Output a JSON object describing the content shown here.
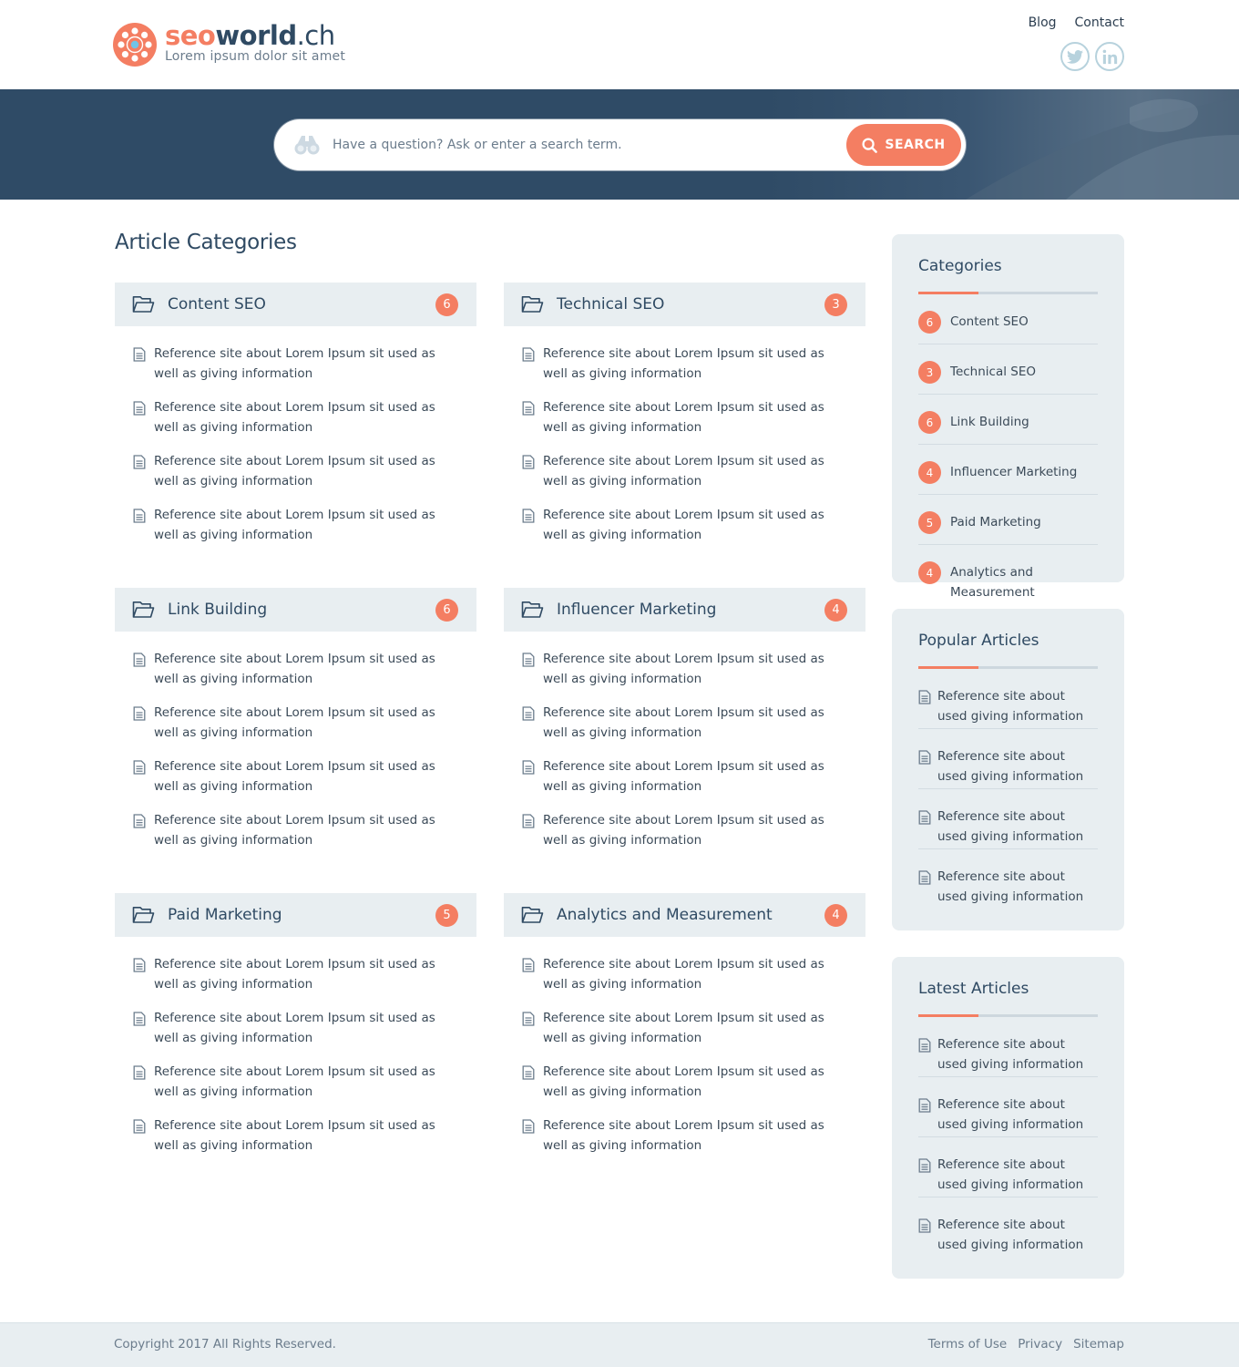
{
  "brand": {
    "name_part1": "seo",
    "name_part2": "world",
    "name_part3": ".ch",
    "tagline": "Lorem ipsum dolor sit amet",
    "accent_color": "#f47e62",
    "dark_color": "#2f4a63"
  },
  "nav": {
    "items": [
      {
        "label": "Blog"
      },
      {
        "label": "Contact"
      }
    ],
    "social": [
      {
        "icon": "twitter-icon"
      },
      {
        "icon": "linkedin-icon"
      }
    ]
  },
  "search": {
    "placeholder": "Have a question? Ask or enter a search term.",
    "button_label": "SEARCH"
  },
  "main": {
    "title": "Article Categories",
    "categories": [
      {
        "title": "Content SEO",
        "count": "6",
        "articles": [
          "Reference site about Lorem Ipsum sit used as well as giving information",
          "Reference site about Lorem Ipsum sit used as well as giving information",
          "Reference site about Lorem Ipsum sit used as well as giving information",
          "Reference site about Lorem Ipsum sit used as well as giving information"
        ]
      },
      {
        "title": "Technical SEO",
        "count": "3",
        "articles": [
          "Reference site about Lorem Ipsum sit used as well as giving information",
          "Reference site about Lorem Ipsum sit used as well as giving information",
          "Reference site about Lorem Ipsum sit used as well as giving information",
          "Reference site about Lorem Ipsum sit used as well as giving information"
        ]
      },
      {
        "title": "Link Building",
        "count": "6",
        "articles": [
          "Reference site about Lorem Ipsum sit used as well as giving information",
          "Reference site about Lorem Ipsum sit used as well as giving information",
          "Reference site about Lorem Ipsum sit used as well as giving information",
          "Reference site about Lorem Ipsum sit used as well as giving information"
        ]
      },
      {
        "title": "Influencer Marketing",
        "count": "4",
        "articles": [
          "Reference site about Lorem Ipsum sit used as well as giving information",
          "Reference site about Lorem Ipsum sit used as well as giving information",
          "Reference site about Lorem Ipsum sit used as well as giving information",
          "Reference site about Lorem Ipsum sit used as well as giving information"
        ]
      },
      {
        "title": "Paid Marketing",
        "count": "5",
        "articles": [
          "Reference site about Lorem Ipsum sit used as well as giving information",
          "Reference site about Lorem Ipsum sit used as well as giving information",
          "Reference site about Lorem Ipsum sit used as well as giving information",
          "Reference site about Lorem Ipsum sit used as well as giving information"
        ]
      },
      {
        "title": "Analytics and Measurement",
        "count": "4",
        "articles": [
          "Reference site about Lorem Ipsum sit used as well as giving information",
          "Reference site about Lorem Ipsum sit used as well as giving information",
          "Reference site about Lorem Ipsum sit used as well as giving information",
          "Reference site about Lorem Ipsum sit used as well as giving information"
        ]
      }
    ]
  },
  "sidebar": {
    "categories": {
      "title": "Categories",
      "items": [
        {
          "count": "6",
          "label": "Content SEO"
        },
        {
          "count": "3",
          "label": "Technical SEO"
        },
        {
          "count": "6",
          "label": "Link Building"
        },
        {
          "count": "4",
          "label": "Influencer Marketing"
        },
        {
          "count": "5",
          "label": "Paid Marketing"
        },
        {
          "count": "4",
          "label": "Analytics and Measurement"
        }
      ]
    },
    "popular": {
      "title": "Popular Articles",
      "items": [
        "Reference site about used giving information",
        "Reference site about used giving information",
        "Reference site about used giving information",
        "Reference site about used giving information"
      ]
    },
    "latest": {
      "title": "Latest Articles",
      "items": [
        "Reference site about used giving information",
        "Reference site about used giving information",
        "Reference site about used giving information",
        "Reference site about used giving information"
      ]
    }
  },
  "footer": {
    "copyright": "Copyright 2017 All Rights Reserved.",
    "links": [
      {
        "label": "Terms of Use"
      },
      {
        "label": "Privacy"
      },
      {
        "label": "Sitemap"
      }
    ]
  }
}
